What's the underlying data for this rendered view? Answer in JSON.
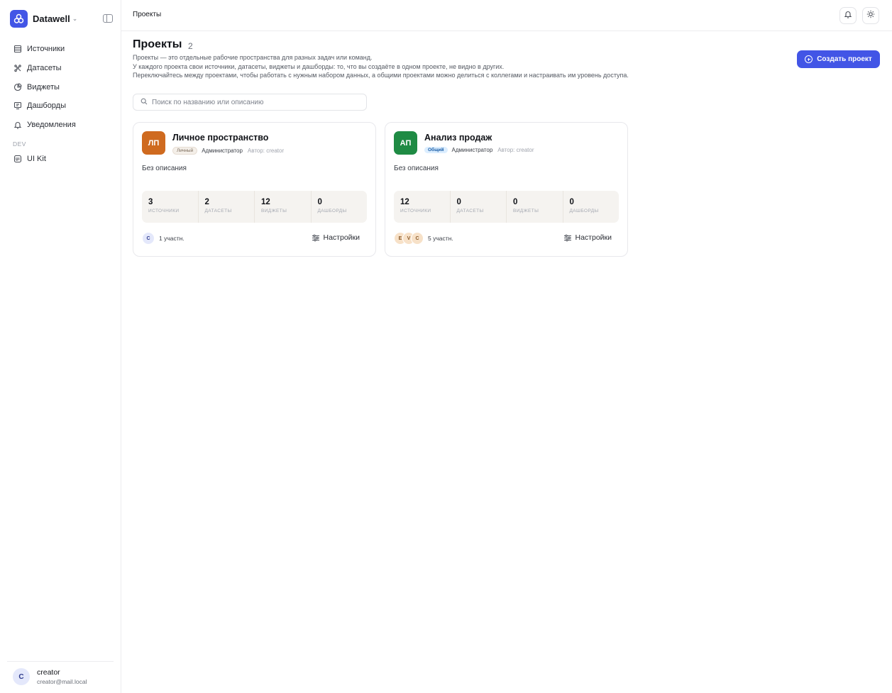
{
  "app": {
    "name": "Datawell",
    "brand_color": "#4255e6"
  },
  "sidebar": {
    "items": [
      {
        "label": "Источники",
        "icon": "database-icon"
      },
      {
        "label": "Датасеты",
        "icon": "dataset-icon"
      },
      {
        "label": "Виджеты",
        "icon": "chart-pie-icon"
      },
      {
        "label": "Дашборды",
        "icon": "dashboard-icon"
      },
      {
        "label": "Уведомления",
        "icon": "bell-icon"
      }
    ],
    "dev_section": "DEV",
    "dev_items": [
      {
        "label": "UI Kit",
        "icon": "ui-kit-icon"
      }
    ],
    "user": {
      "initial": "C",
      "name": "creator",
      "email": "creator@mail.local"
    }
  },
  "header": {
    "breadcrumb": "Проекты",
    "notifications_icon": "bell-icon",
    "theme_icon": "sun-icon"
  },
  "main": {
    "title": "Проекты",
    "count": "2",
    "description": [
      "Проекты — это отдельные рабочие пространства для разных задач или команд.",
      "У каждого проекта свои источники, датасеты, виджеты и дашборды: то, что вы создаёте в одном проекте, не видно в других.",
      "Переключайтесь между проектами, чтобы работать с нужным набором данных, а общими проектами можно делиться с коллегами и настраивать им уровень доступа."
    ],
    "create_button": "Создать проект",
    "search_placeholder": "Поиск по названию или описанию",
    "projects": [
      {
        "initials": "ЛП",
        "avatar_color": "#cf6a1f",
        "title": "Личное пространство",
        "tag": "Личный",
        "role": "Администратор",
        "author": "Автор: creator",
        "description": "Без описания",
        "stats": [
          {
            "value": "3",
            "label": "ИСТОЧНИКИ"
          },
          {
            "value": "2",
            "label": "ДАТАСЕТЫ"
          },
          {
            "value": "12",
            "label": "ВИДЖЕТЫ"
          },
          {
            "value": "0",
            "label": "ДАШБОРДЫ"
          }
        ],
        "members": [
          "C"
        ],
        "members_count": "1 участн.",
        "settings_label": "Настройки"
      },
      {
        "initials": "АП",
        "avatar_color": "#1f8b44",
        "title": "Анализ продаж",
        "tag": "Общий",
        "role": "Администратор",
        "author": "Автор: creator",
        "description": "Без описания",
        "stats": [
          {
            "value": "12",
            "label": "ИСТОЧНИКИ"
          },
          {
            "value": "0",
            "label": "ДАТАСЕТЫ"
          },
          {
            "value": "0",
            "label": "ВИДЖЕТЫ"
          },
          {
            "value": "0",
            "label": "ДАШБОРДЫ"
          }
        ],
        "members": [
          "E",
          "V",
          "C"
        ],
        "members_count": "5 участн.",
        "settings_label": "Настройки"
      }
    ]
  }
}
